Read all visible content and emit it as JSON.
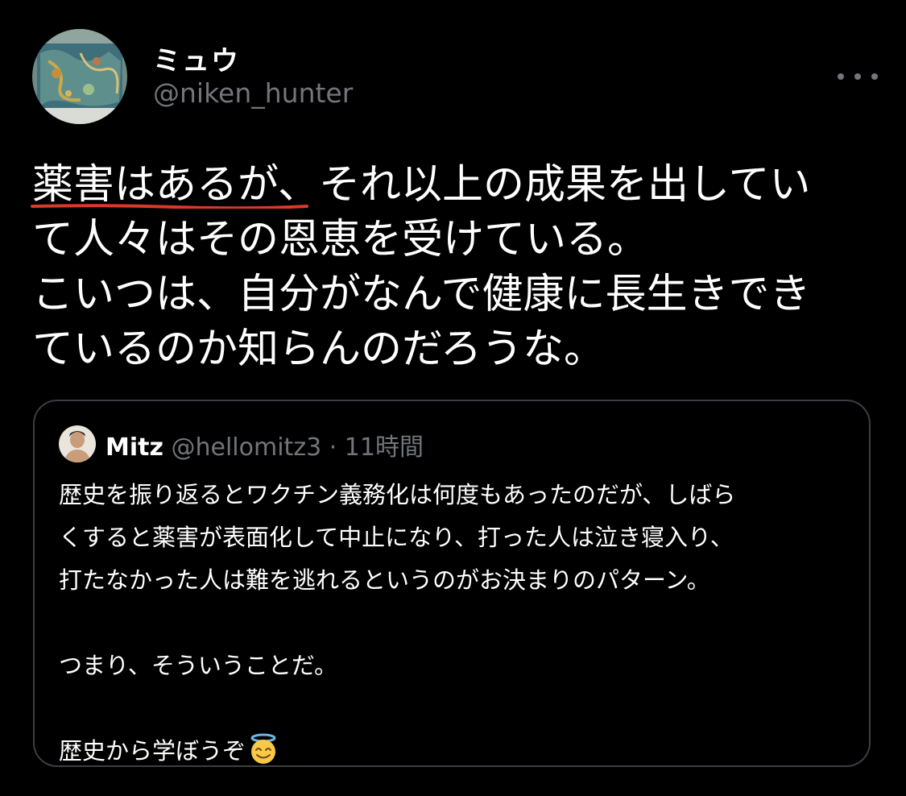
{
  "author": {
    "display_name": "ミュウ",
    "handle": "@niken_hunter"
  },
  "more_icon": "more-horizontal-icon",
  "tweet": {
    "lines": [
      "薬害はあるが、それ以上の成果を出してい",
      "て人々はその恩恵を受けている。",
      "こいつは、自分がなんで健康に長生きでき",
      "ているのか知らんのだろうな。"
    ],
    "highlight_color": "#d93a2b"
  },
  "quoted_tweet": {
    "display_name": "Mitz",
    "handle": "@hellomitz3",
    "separator": "·",
    "time": "11時間",
    "lines": [
      "歴史を振り返るとワクチン義務化は何度もあったのだが、しばら",
      "くすると薬害が表面化して中止になり、打った人は泣き寝入り、",
      "打たなかった人は難を逃れるというのがお決まりのパターン。",
      "",
      "つまり、そういうことだ。",
      "",
      "歴史から学ぼうぞ"
    ],
    "emoji": "smiling-face-with-halo-icon"
  }
}
